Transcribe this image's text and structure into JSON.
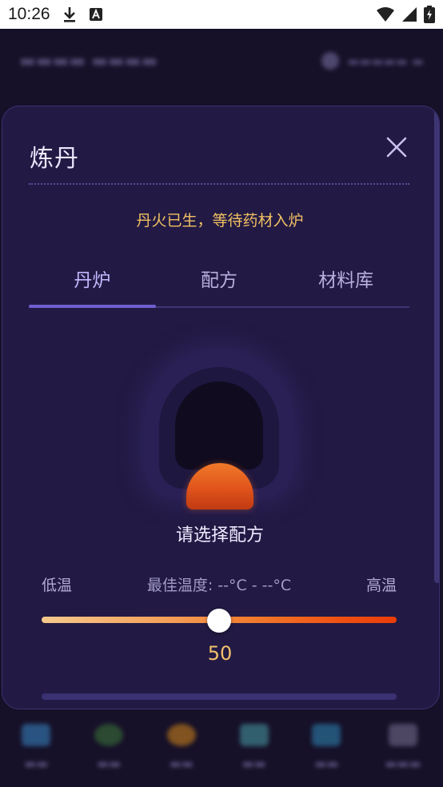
{
  "status_bar": {
    "time": "10:26",
    "left_icons": [
      "download-icon",
      "autofill-icon"
    ],
    "right_icons": [
      "wifi-icon",
      "signal-icon",
      "battery-charging-icon"
    ]
  },
  "modal": {
    "title": "炼丹",
    "close_icon": "close-icon",
    "status_message": "丹火已生，等待药材入炉",
    "tabs": [
      {
        "label": "丹炉",
        "active": true
      },
      {
        "label": "配方",
        "active": false
      },
      {
        "label": "材料库",
        "active": false
      }
    ],
    "furnace": {
      "prompt": "请选择配方"
    },
    "temperature": {
      "low_label": "低温",
      "optimal_label": "最佳温度: --°C - --°C",
      "high_label": "高温",
      "value": "50",
      "slider_fraction": 0.5
    }
  },
  "colors": {
    "modal_bg": "#221a44",
    "accent": "#6e5fd0",
    "status_text": "#f2c063",
    "fire": "#e0541b"
  }
}
